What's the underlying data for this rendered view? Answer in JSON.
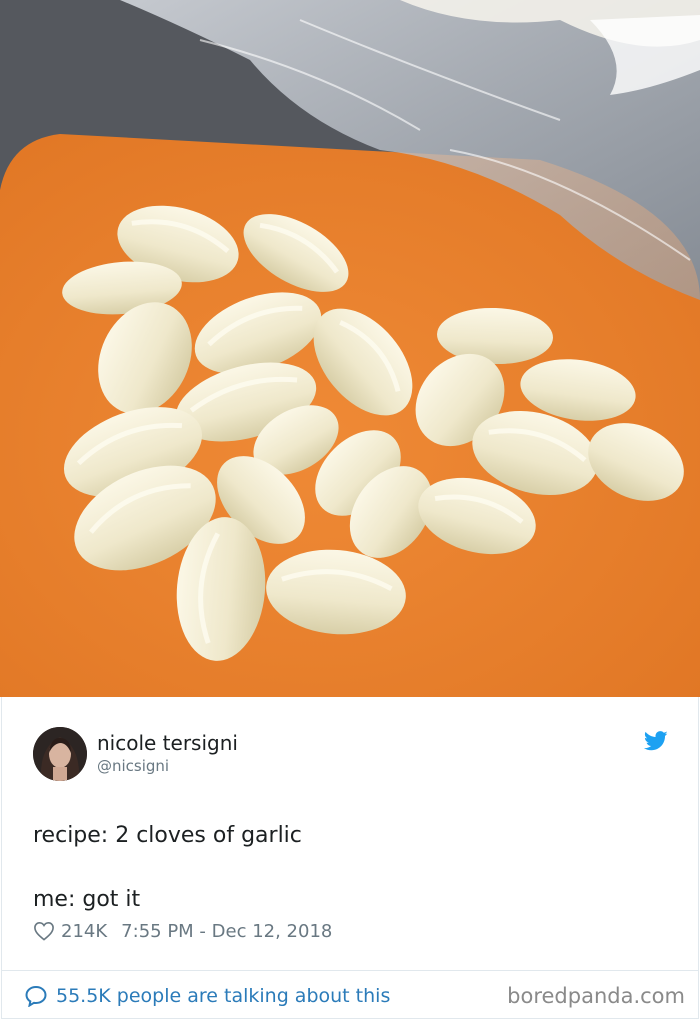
{
  "tweet": {
    "author_name": "nicole tersigni",
    "author_handle": "@nicsigni",
    "text": "recipe: 2 cloves of garlic\n\nme: got it",
    "likes": "214K",
    "timestamp": "7:55 PM - Dec 12, 2018",
    "conversation": "55.5K people are talking about this"
  },
  "watermark": "boredpanda.com",
  "icons": {
    "brand": "twitter-bird-icon",
    "like": "heart-icon",
    "conversation": "speech-bubble-icon"
  },
  "colors": {
    "board": "#e8822f",
    "garlic": "#f1ebd0",
    "twitter_blue": "#1da1f2",
    "link_blue": "#2b7bb9"
  }
}
